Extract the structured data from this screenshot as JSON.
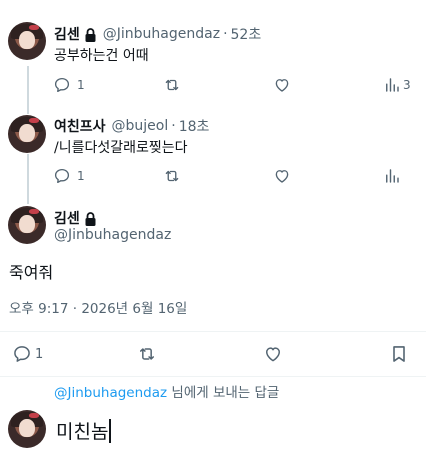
{
  "posts": [
    {
      "name": "김센",
      "handle": "@Jinbuhagendaz",
      "time": "52초",
      "text": "공부하는건 어때",
      "actions": {
        "reply": "1",
        "repost": "",
        "like": "",
        "views": "3"
      }
    },
    {
      "name": "여친프사",
      "handle": "@bujeol",
      "time": "18초",
      "text": "/니를다섯갈래로찢는다",
      "actions": {
        "reply": "1",
        "repost": "",
        "like": "",
        "views": ""
      }
    }
  ],
  "main_post": {
    "name": "김센",
    "handle": "@Jinbuhagendaz",
    "text": "죽여줘",
    "meta": "오후 9:17 · 2026년 6월 16일",
    "actions": {
      "reply": "1"
    }
  },
  "reply": {
    "to_handle": "@Jinbuhagendaz",
    "to_suffix": " 님에게 보내는 답글",
    "draft": "미친놈"
  },
  "more_label": "···",
  "separator": "·"
}
